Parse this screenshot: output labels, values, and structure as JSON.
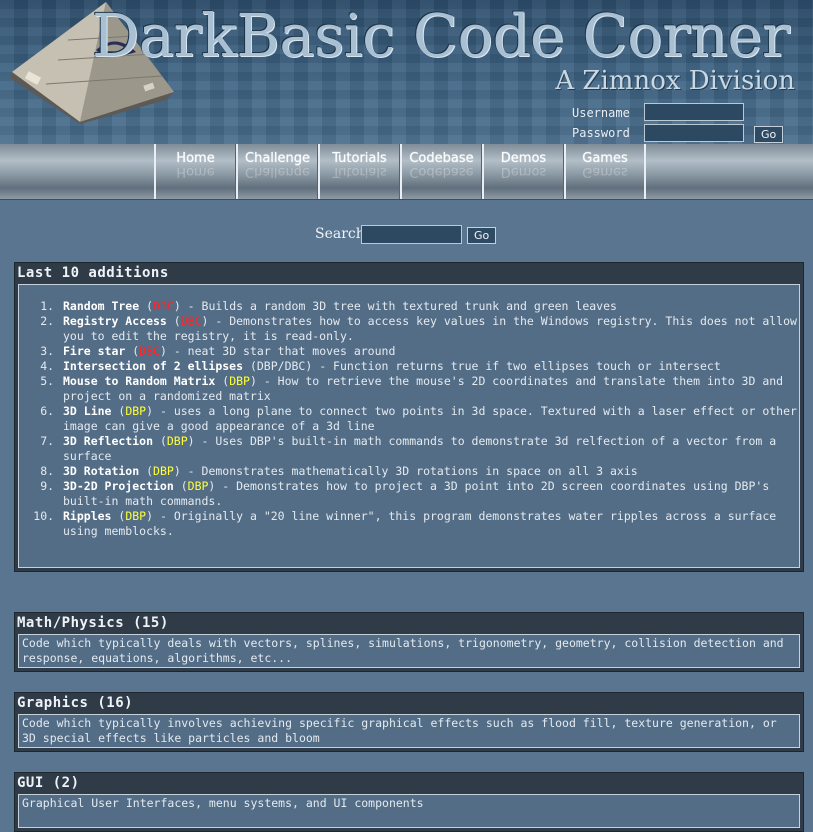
{
  "header": {
    "title": "DarkBasic Code Corner",
    "subtitle": "A Zimnox Division",
    "username_label": "Username",
    "password_label": "Password",
    "go_label": "Go"
  },
  "nav": {
    "items": [
      {
        "label": "Home"
      },
      {
        "label": "Challenge"
      },
      {
        "label": "Tutorials"
      },
      {
        "label": "Codebase"
      },
      {
        "label": "Demos"
      },
      {
        "label": "Games"
      }
    ]
  },
  "search": {
    "label": "Search",
    "go_label": "Go"
  },
  "recent": {
    "title": "Last 10 additions",
    "items": [
      {
        "title": "Random Tree",
        "tag": "DBC",
        "desc": " - Builds a random 3D tree with textured trunk and green leaves"
      },
      {
        "title": "Registry Access",
        "tag": "DBC",
        "desc": " - Demonstrates how to access key values in the Windows registry. This does not allow you to edit the registry, it is read-only."
      },
      {
        "title": "Fire star",
        "tag": "DBC",
        "desc": " - neat 3D star that moves around"
      },
      {
        "title": "Intersection of 2 ellipses",
        "tag": "DBP/DBC",
        "desc": " - Function returns true if two ellipses touch or intersect"
      },
      {
        "title": "Mouse to Random Matrix",
        "tag": "DBP",
        "desc": " - How to retrieve the mouse's 2D coordinates and translate them into 3D and project on a randomized matrix"
      },
      {
        "title": "3D Line",
        "tag": "DBP",
        "desc": " - uses a long plane to connect two points in 3d space. Textured with a laser effect or other image can give a good appearance of a 3d line"
      },
      {
        "title": "3D Reflection",
        "tag": "DBP",
        "desc": " - Uses DBP's built-in math commands to demonstrate 3d relfection of a vector from a surface"
      },
      {
        "title": "3D Rotation",
        "tag": "DBP",
        "desc": " - Demonstrates mathematically 3D rotations in space on all 3 axis"
      },
      {
        "title": "3D-2D Projection",
        "tag": "DBP",
        "desc": " - Demonstrates how to project a 3D point into 2D screen coordinates using DBP's built-in math commands."
      },
      {
        "title": "Ripples",
        "tag": "DBP",
        "desc": " - Originally a \"20 line winner\", this program demonstrates water ripples across a surface using memblocks."
      }
    ]
  },
  "categories": [
    {
      "title": "Math/Physics (15)",
      "desc": "Code which typically deals with vectors, splines, simulations, trigonometry, geometry, collision detection and response, equations, algorithms, etc..."
    },
    {
      "title": "Graphics (16)",
      "desc": "Code which typically involves achieving specific graphical effects such as flood fill, texture generation, or 3D special effects like particles and bloom"
    },
    {
      "title": "GUI (2)",
      "desc": "Graphical User Interfaces, menu systems, and UI components"
    }
  ],
  "colors": {
    "page_bg": "#5a7590",
    "panel_frame": "#2f3b46",
    "panel_body": "#546d86",
    "tag_dbc": "#ff2424",
    "tag_dbp": "#ffff3a"
  },
  "icons": {
    "logo": "pyramid-logo-icon"
  }
}
